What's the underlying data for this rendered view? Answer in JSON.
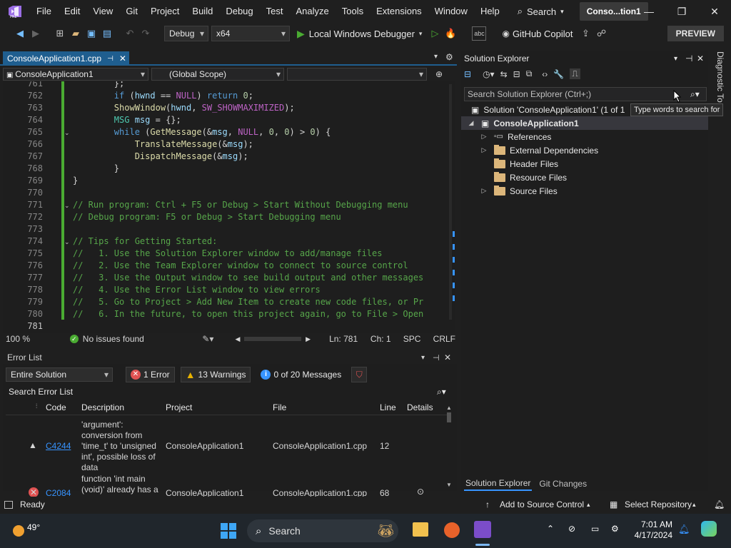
{
  "menu": {
    "items": [
      "File",
      "Edit",
      "View",
      "Git",
      "Project",
      "Build",
      "Debug",
      "Test",
      "Analyze",
      "Tools",
      "Extensions",
      "Window",
      "Help"
    ],
    "search_label": "Search",
    "title_chip": "Conso...tion1"
  },
  "toolbar": {
    "config": "Debug",
    "platform": "x64",
    "run_label": "Local Windows Debugger",
    "copilot_label": "GitHub Copilot",
    "preview_label": "PREVIEW"
  },
  "editor": {
    "tab_title": "ConsoleApplication1.cpp",
    "nav_project": "ConsoleApplication1",
    "nav_scope": "(Global Scope)",
    "zoom": "100 %",
    "issues": "No issues found",
    "line_info": "Ln: 781",
    "char_info": "Ch: 1",
    "spc": "SPC",
    "crlf": "CRLF",
    "lines": [
      {
        "n": "761",
        "text": "        };"
      },
      {
        "n": "762",
        "text": "        if (hwnd == NULL) return 0;"
      },
      {
        "n": "763",
        "text": "        ShowWindow(hwnd, SW_SHOWMAXIMIZED);"
      },
      {
        "n": "764",
        "text": "        MSG msg = {};"
      },
      {
        "n": "765",
        "text": "        while (GetMessage(&msg, NULL, 0, 0) > 0) {"
      },
      {
        "n": "766",
        "text": "            TranslateMessage(&msg);"
      },
      {
        "n": "767",
        "text": "            DispatchMessage(&msg);"
      },
      {
        "n": "768",
        "text": "        }"
      },
      {
        "n": "769",
        "text": "}"
      },
      {
        "n": "770",
        "text": ""
      },
      {
        "n": "771",
        "text": "// Run program: Ctrl + F5 or Debug > Start Without Debugging menu"
      },
      {
        "n": "772",
        "text": "// Debug program: F5 or Debug > Start Debugging menu"
      },
      {
        "n": "773",
        "text": ""
      },
      {
        "n": "774",
        "text": "// Tips for Getting Started:"
      },
      {
        "n": "775",
        "text": "//   1. Use the Solution Explorer window to add/manage files"
      },
      {
        "n": "776",
        "text": "//   2. Use the Team Explorer window to connect to source control"
      },
      {
        "n": "777",
        "text": "//   3. Use the Output window to see build output and other messages"
      },
      {
        "n": "778",
        "text": "//   4. Use the Error List window to view errors"
      },
      {
        "n": "779",
        "text": "//   5. Go to Project > Add New Item to create new code files, or Pr"
      },
      {
        "n": "780",
        "text": "//   6. In the future, to open this project again, go to File > Open"
      },
      {
        "n": "781",
        "text": ""
      }
    ]
  },
  "error_list": {
    "title": "Error List",
    "scope": "Entire Solution",
    "errors": "1 Error",
    "warnings": "13 Warnings",
    "messages": "0 of 20 Messages",
    "search_placeholder": "Search Error List",
    "columns": [
      "Code",
      "Description",
      "Project",
      "File",
      "Line",
      "Details"
    ],
    "rows": [
      {
        "code": "C4244",
        "desc": [
          "'argument':",
          "conversion from",
          "'time_t' to 'unsigned",
          "int', possible loss of",
          "data"
        ],
        "project": "ConsoleApplication1",
        "file": "ConsoleApplication1.cpp",
        "line": "12"
      },
      {
        "code": "C2084",
        "desc": [
          "function 'int main",
          "(void)' already has a"
        ],
        "project": "ConsoleApplication1",
        "file": "ConsoleApplication1.cpp",
        "line": "68"
      }
    ]
  },
  "solution_explorer": {
    "title": "Solution Explorer",
    "search_placeholder": "Search Solution Explorer (Ctrl+;)",
    "solution_label": "Solution 'ConsoleApplication1' (1 of 1",
    "project_label": "ConsoleApplication1",
    "nodes": [
      "References",
      "External Dependencies",
      "Header Files",
      "Resource Files",
      "Source Files"
    ],
    "tooltip": "Type words to search for",
    "tabs": [
      "Solution Explorer",
      "Git Changes"
    ]
  },
  "diag_tab": "Diagnostic To",
  "status": {
    "ready": "Ready",
    "add_source": "Add to Source Control",
    "select_repo": "Select Repository"
  },
  "taskbar": {
    "weather": "49°",
    "search": "Search",
    "time": "7:01 AM",
    "date": "4/17/2024"
  },
  "colors": {
    "accent": "#1f5e8f",
    "error": "#e05252",
    "warning": "#e8b200",
    "info": "#3794ff",
    "green_bar": "#4aab32"
  }
}
